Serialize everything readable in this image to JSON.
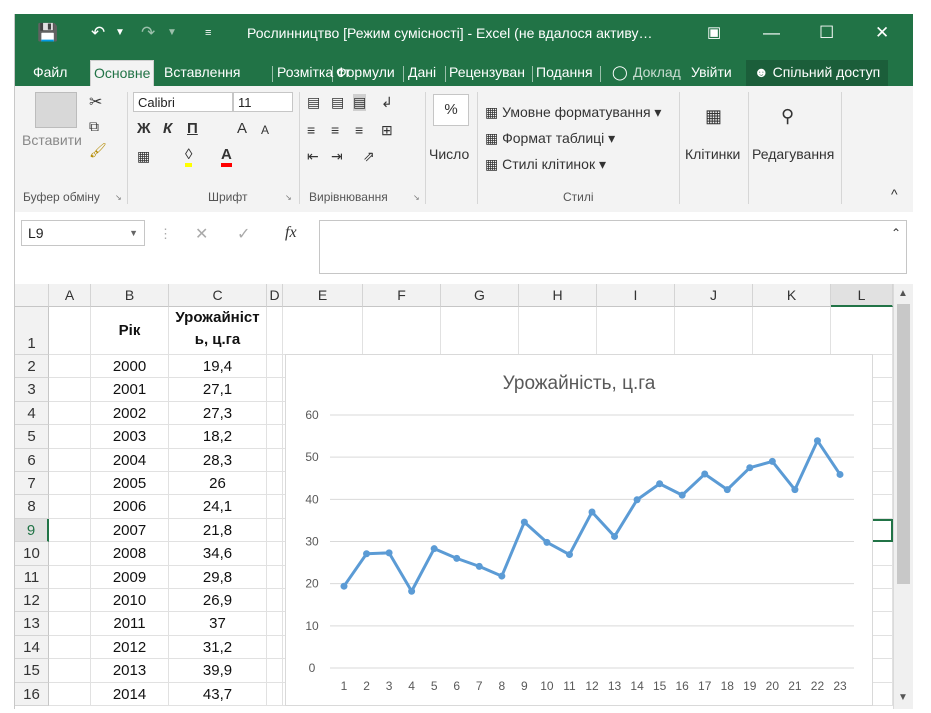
{
  "titlebar": {
    "save_icon": "save-icon",
    "undo_icon": "undo-icon",
    "redo_icon": "redo-icon",
    "title": "Рослинництво  [Режим сумісності] - Excel (не вдалося активу…",
    "ribbon_display_icon": "ribbon-display-icon",
    "minimize": "—",
    "maximize": "☐",
    "close": "✕"
  },
  "tabs": {
    "file": "Файл",
    "home": "Основне",
    "insert": "Вставлення",
    "layout": "Розмітка ст",
    "formulas": "Формули",
    "data": "Дані",
    "review": "Рецензуван",
    "view": "Подання",
    "tellme": "Доклад",
    "signin": "Увійти",
    "share": "Спільний доступ"
  },
  "ribbon": {
    "clipboard": {
      "paste": "Вставити",
      "label": "Буфер обміну"
    },
    "font": {
      "name": "Calibri",
      "size": "11",
      "bold": "Ж",
      "italic": "К",
      "underline": "П",
      "grow": "A",
      "shrink": "A",
      "label": "Шрифт"
    },
    "alignment": {
      "label": "Вирівнювання"
    },
    "number": {
      "symbol": "%",
      "label_btn": "Число"
    },
    "styles": {
      "conditional": "Умовне форматування",
      "table": "Формат таблиці",
      "cell_styles": "Стилі клітинок",
      "label": "Стилі"
    },
    "cells": {
      "label": "Клітинки"
    },
    "editing": {
      "label": "Редагування"
    },
    "collapse": "^"
  },
  "formula": {
    "namebox": "L9",
    "cancel": "✕",
    "enter": "✓",
    "fx": "fx",
    "value": ""
  },
  "sheet": {
    "columns": [
      "A",
      "B",
      "C",
      "D",
      "E",
      "F",
      "G",
      "H",
      "I",
      "J",
      "K",
      "L"
    ],
    "header_b": "Рік",
    "header_c_line1": "Урожайніст",
    "header_c_line2": "ь, ц.га",
    "rows": [
      {
        "num": "1",
        "b": "",
        "c": ""
      },
      {
        "num": "2",
        "b": "2000",
        "c": "19,4"
      },
      {
        "num": "3",
        "b": "2001",
        "c": "27,1"
      },
      {
        "num": "4",
        "b": "2002",
        "c": "27,3"
      },
      {
        "num": "5",
        "b": "2003",
        "c": "18,2"
      },
      {
        "num": "6",
        "b": "2004",
        "c": "28,3"
      },
      {
        "num": "7",
        "b": "2005",
        "c": "26"
      },
      {
        "num": "8",
        "b": "2006",
        "c": "24,1"
      },
      {
        "num": "9",
        "b": "2007",
        "c": "21,8"
      },
      {
        "num": "10",
        "b": "2008",
        "c": "34,6"
      },
      {
        "num": "11",
        "b": "2009",
        "c": "29,8"
      },
      {
        "num": "12",
        "b": "2010",
        "c": "26,9"
      },
      {
        "num": "13",
        "b": "2011",
        "c": "37"
      },
      {
        "num": "14",
        "b": "2012",
        "c": "31,2"
      },
      {
        "num": "15",
        "b": "2013",
        "c": "39,9"
      },
      {
        "num": "16",
        "b": "2014",
        "c": "43,7"
      }
    ]
  },
  "colors": {
    "excel_green": "#217346",
    "series": "#5b9bd5",
    "gridline": "#d9d9d9",
    "selected": "#217346"
  },
  "chart_data": {
    "type": "line",
    "title": "Урожайність, ц.га",
    "xlabel": "",
    "ylabel": "",
    "x": [
      1,
      2,
      3,
      4,
      5,
      6,
      7,
      8,
      9,
      10,
      11,
      12,
      13,
      14,
      15,
      16,
      17,
      18,
      19,
      20,
      21,
      22,
      23
    ],
    "yticks": [
      0,
      10,
      20,
      30,
      40,
      50,
      60
    ],
    "ylim": [
      0,
      60
    ],
    "grid": true,
    "legend": "none",
    "series": [
      {
        "values": [
          19.4,
          27.1,
          27.3,
          18.2,
          28.3,
          26,
          24.1,
          21.8,
          34.6,
          29.8,
          26.9,
          37,
          31.2,
          39.9,
          43.7,
          41,
          46,
          42.3,
          47.5,
          49,
          42.3,
          53.9,
          45.9
        ]
      }
    ]
  }
}
